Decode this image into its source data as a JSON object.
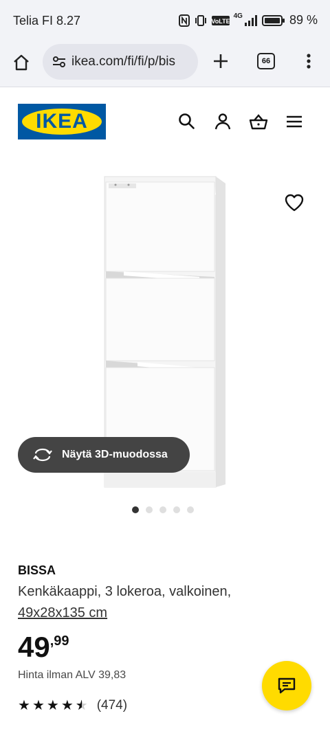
{
  "status_bar": {
    "carrier_time": "Telia FI 8.27",
    "net_label": "4G",
    "battery": "89 %"
  },
  "browser": {
    "url": "ikea.com/fi/fi/p/bis",
    "tab_count": "66"
  },
  "header": {
    "logo_text": "IKEA"
  },
  "gallery": {
    "view_3d_label": "Näytä 3D-muodossa",
    "slide_count": 5,
    "active_slide": 1
  },
  "product": {
    "name": "BISSA",
    "description": "Kenkäkaappi, 3 lokeroa, valkoinen,",
    "measurements": "49x28x135 cm",
    "price_int": "49",
    "price_dec": ",99",
    "vat_text": "Hinta ilman ALV 39,83",
    "rating_value": 4.5,
    "review_count": "(474)"
  },
  "colors": {
    "ikea_blue": "#0058a3",
    "ikea_yellow": "#ffdb00"
  }
}
